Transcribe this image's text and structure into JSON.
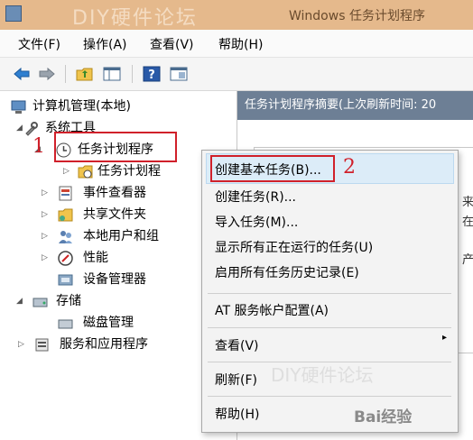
{
  "titlebar": {
    "watermark": "DIY硬件论坛",
    "window_title": "Windows 任务计划程序"
  },
  "menu": [
    "文件(F)",
    "操作(A)",
    "查看(V)",
    "帮助(H)"
  ],
  "toolbar": {
    "icons": [
      "back-icon",
      "forward-icon",
      "up-folder-icon",
      "show-hide-tree-icon",
      "help-icon",
      "properties-icon"
    ]
  },
  "tree": {
    "root": "计算机管理(本地)",
    "system_tools": "系统工具",
    "task_scheduler": "任务计划程序",
    "task_scheduler_lib": "任务计划程",
    "event_viewer": "事件查看器",
    "shared_folders": "共享文件夹",
    "local_users": "本地用户和组",
    "performance": "性能",
    "device_manager": "设备管理器",
    "storage": "存储",
    "disk_management": "磁盘管理",
    "services_apps": "服务和应用程序"
  },
  "right_pane": {
    "header": "任务计划程序摘要(上次刷新时间: 20",
    "side_chars": [
      "来",
      "在",
      "产"
    ]
  },
  "annotations": {
    "n1": "1",
    "n2": "2"
  },
  "context_menu": {
    "items": [
      "创建基本任务(B)...",
      "创建任务(R)...",
      "导入任务(M)...",
      "显示所有正在运行的任务(U)",
      "启用所有任务历史记录(E)",
      "AT 服务帐户配置(A)",
      "查看(V)",
      "刷新(F)",
      "帮助(H)"
    ],
    "submenu_arrow": "▸"
  },
  "watermarks": {
    "bottom": "DIY硬件论坛",
    "baidu": "Bai经验"
  }
}
